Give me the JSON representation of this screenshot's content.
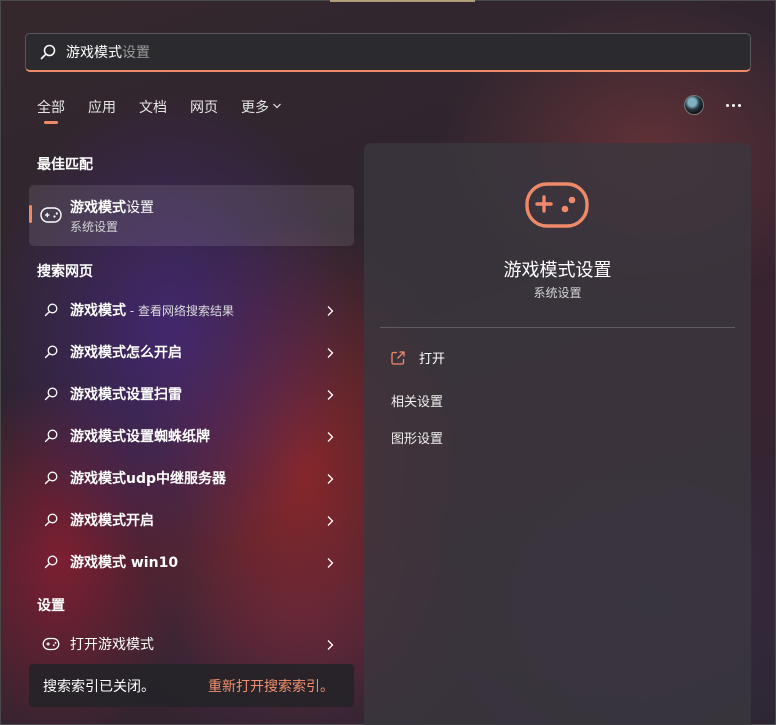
{
  "search": {
    "typed": "游戏模式",
    "suggestion": "设置"
  },
  "tabs": [
    {
      "label": "全部",
      "active": true
    },
    {
      "label": "应用",
      "active": false
    },
    {
      "label": "文档",
      "active": false
    },
    {
      "label": "网页",
      "active": false
    },
    {
      "label": "更多",
      "active": false
    }
  ],
  "left": {
    "best_match_heading": "最佳匹配",
    "best_match": {
      "title_bold": "游戏模式",
      "title_rest": "设置",
      "subtitle": "系统设置",
      "icon": "gamepad-icon"
    },
    "web_heading": "搜索网页",
    "web_items": [
      {
        "bold": "游戏模式",
        "rest": " - 查看网络搜索结果"
      },
      {
        "bold": "游戏模式怎么开启",
        "rest": ""
      },
      {
        "bold": "游戏模式设置扫雷",
        "rest": ""
      },
      {
        "bold": "游戏模式设置蜘蛛纸牌",
        "rest": ""
      },
      {
        "bold": "游戏模式udp中继服务器",
        "rest": ""
      },
      {
        "bold": "游戏模式开启",
        "rest": ""
      },
      {
        "bold": "游戏模式 win10",
        "rest": ""
      }
    ],
    "settings_heading": "设置",
    "settings_items": [
      {
        "label": "打开游戏模式",
        "icon": "gamepad-icon"
      }
    ],
    "index_bar": {
      "message": "搜索索引已关闭。",
      "link": "重新打开搜索索引。"
    }
  },
  "detail": {
    "title": "游戏模式设置",
    "subtitle": "系统设置",
    "open_label": "打开",
    "related_label": "相关设置",
    "graphics_label": "图形设置"
  },
  "colors": {
    "accent": "#ee8a6a"
  }
}
